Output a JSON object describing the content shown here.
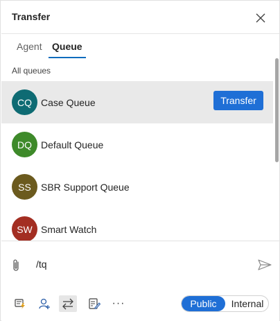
{
  "popup": {
    "title": "Transfer",
    "tabs": [
      {
        "label": "Agent",
        "selected": false
      },
      {
        "label": "Queue",
        "selected": true
      }
    ],
    "section_label": "All queues",
    "queues": [
      {
        "initials": "CQ",
        "name": "Case Queue",
        "color": "#0e6b73",
        "selected": true
      },
      {
        "initials": "DQ",
        "name": "Default Queue",
        "color": "#3e8a2a",
        "selected": false
      },
      {
        "initials": "SS",
        "name": "SBR Support Queue",
        "color": "#6b5a1e",
        "selected": false
      },
      {
        "initials": "SW",
        "name": "Smart Watch",
        "color": "#a32e22",
        "selected": false
      }
    ],
    "transfer_button_label": "Transfer"
  },
  "compose": {
    "message_text": "/tq",
    "toolbar_icons": [
      "quick-reply-icon",
      "add-participant-icon",
      "transfer-icon",
      "notes-icon",
      "more-icon"
    ],
    "visibility": {
      "options": [
        "Public",
        "Internal"
      ],
      "selected": "Public"
    }
  },
  "colors": {
    "accent": "#1f6fd6",
    "selected_row": "#e9e9e9"
  }
}
